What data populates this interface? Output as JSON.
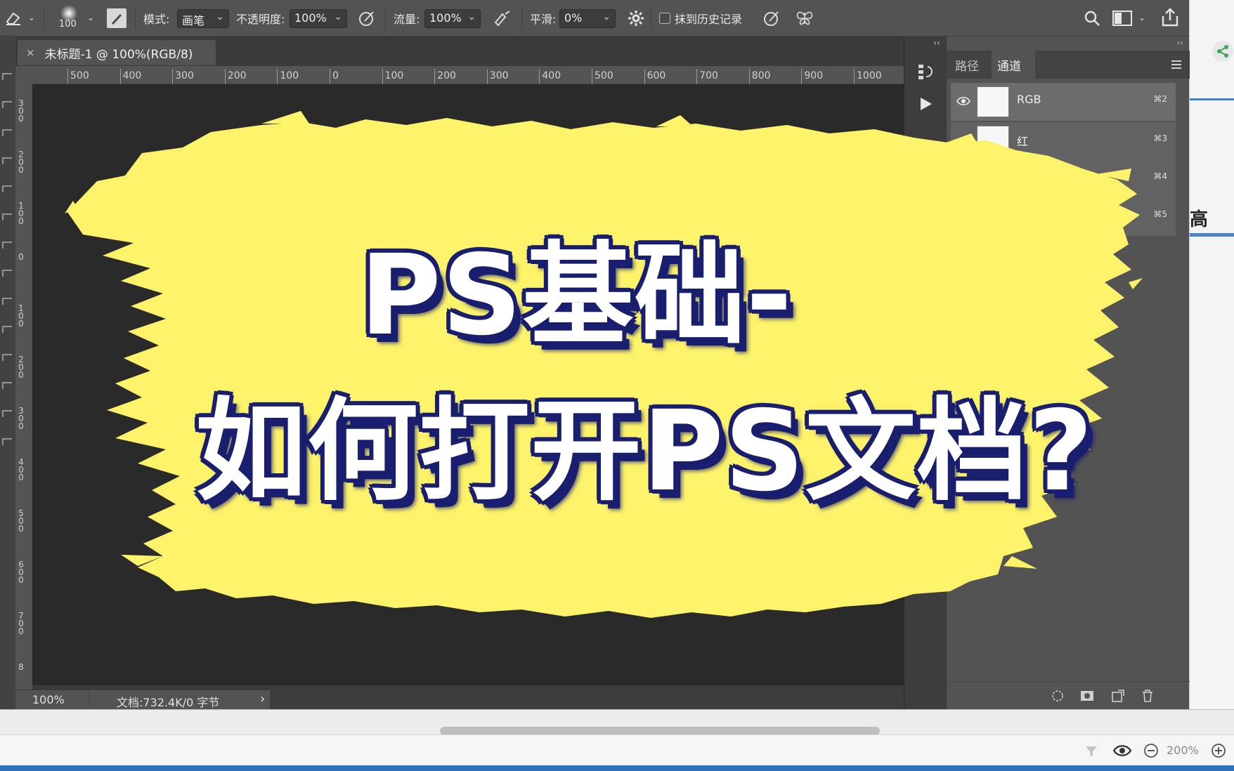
{
  "options_bar": {
    "brush_size": "100",
    "mode_label": "模式:",
    "mode_value": "画笔",
    "opacity_label": "不透明度:",
    "opacity_value": "100%",
    "flow_label": "流量:",
    "flow_value": "100%",
    "smooth_label": "平滑:",
    "smooth_value": "0%",
    "erase_history_label": "抹到历史记录"
  },
  "document": {
    "tab_title": "未标题-1 @ 100%(RGB/8)",
    "close_glyph": "×"
  },
  "ruler": {
    "h_labels": [
      "500",
      "400",
      "300",
      "200",
      "100",
      "0",
      "100",
      "200",
      "300",
      "400",
      "500",
      "600",
      "700",
      "800",
      "900",
      "1000"
    ],
    "v_labels": [
      "3\n0\n0",
      "2\n0\n0",
      "1\n0\n0",
      "0",
      "1\n0\n0",
      "2\n0\n0",
      "3\n0\n0",
      "4\n0\n0",
      "5\n0\n0",
      "6\n0\n0",
      "7\n0\n0",
      "8"
    ]
  },
  "status_bar": {
    "zoom": "100%",
    "doc_info": "文档:732.4K/0 字节",
    "arrow": "›"
  },
  "channels_panel": {
    "tabs": [
      "路径",
      "通道"
    ],
    "active_tab": "通道",
    "channels": [
      {
        "name": "RGB",
        "shortcut": "⌘2"
      },
      {
        "name": "红",
        "shortcut": "⌘3"
      },
      {
        "name": "",
        "shortcut": "⌘4"
      },
      {
        "name": "",
        "shortcut": "⌘5"
      }
    ]
  },
  "side_strip": {
    "partial_text": "高"
  },
  "bottom_bar": {
    "zoom": "200%"
  },
  "overlay": {
    "line1": "PS基础-",
    "line2": "如何打开PS文档?",
    "brush_color": "#fdf36a",
    "text_color": "#ffffff",
    "outline_color": "#191f6e"
  }
}
